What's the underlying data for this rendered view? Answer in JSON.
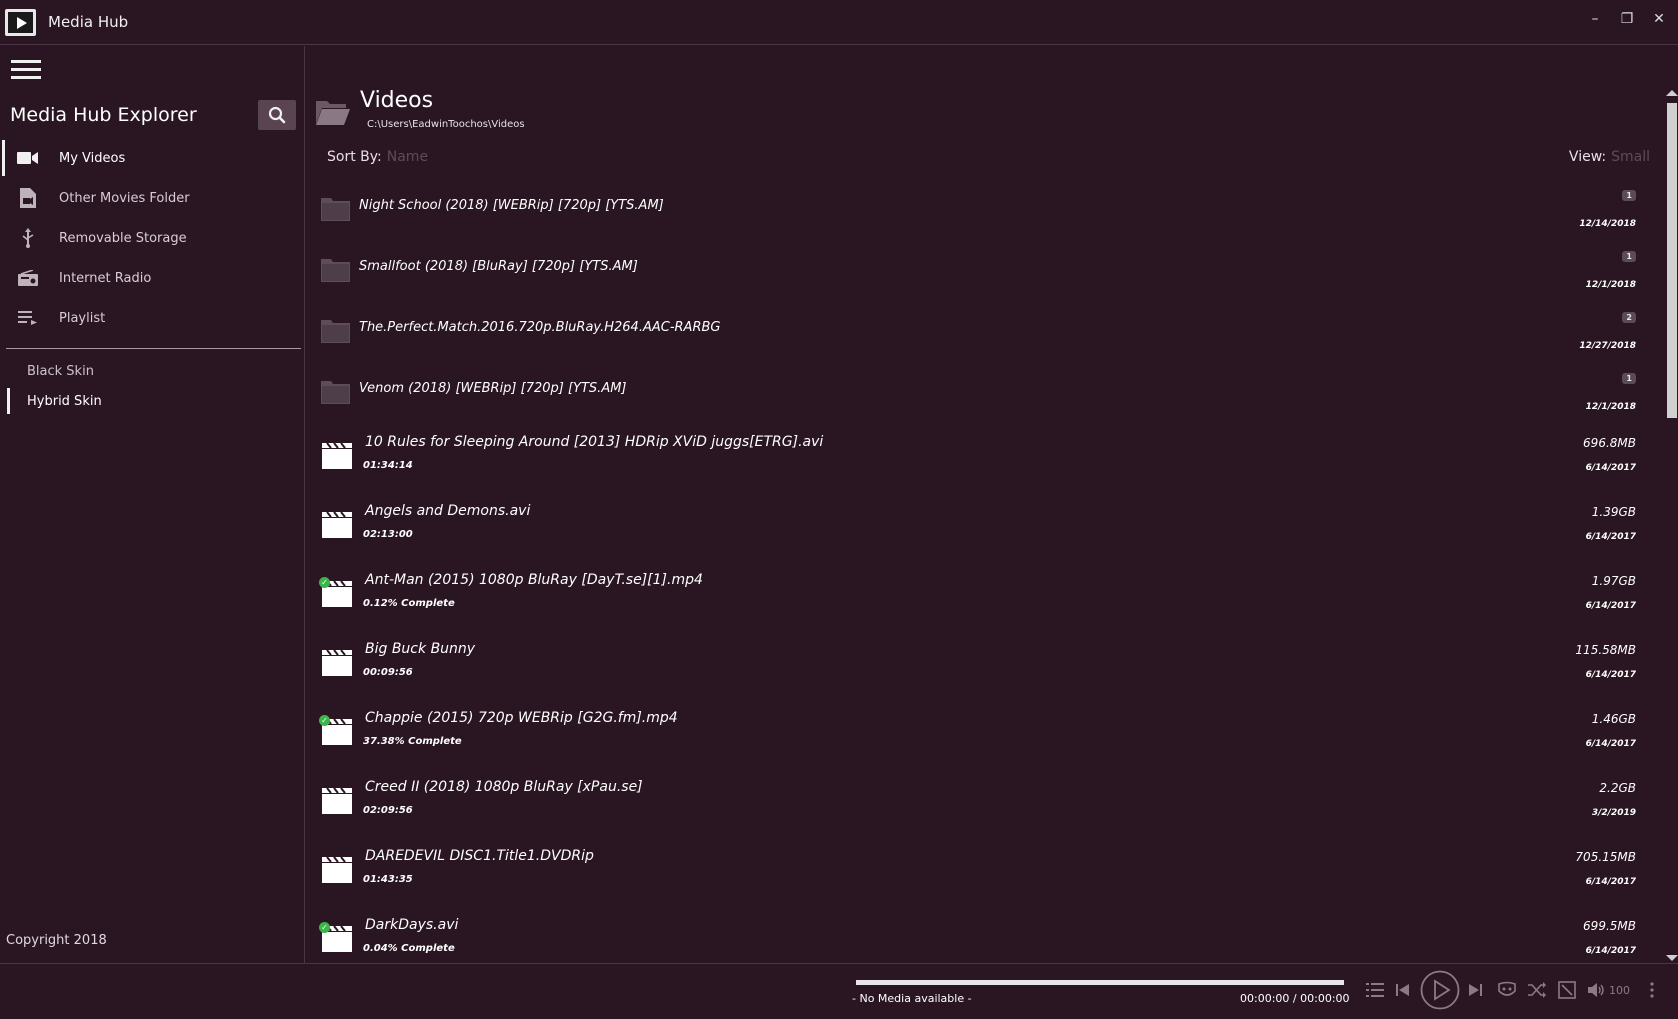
{
  "app": {
    "title": "Media Hub"
  },
  "window": {
    "minimize": "–",
    "restore": "❐",
    "close": "✕"
  },
  "sidebar": {
    "title": "Media Hub Explorer",
    "items": [
      {
        "label": "My Videos",
        "icon": "video-camera-icon",
        "active": true
      },
      {
        "label": "Other Movies Folder",
        "icon": "movie-file-icon",
        "active": false
      },
      {
        "label": "Removable Storage",
        "icon": "usb-icon",
        "active": false
      },
      {
        "label": "Internet Radio",
        "icon": "radio-icon",
        "active": false
      },
      {
        "label": "Playlist",
        "icon": "playlist-icon",
        "active": false
      }
    ],
    "skins": [
      {
        "label": "Black Skin",
        "active": false
      },
      {
        "label": "Hybrid Skin",
        "active": true
      }
    ],
    "copyright": "Copyright 2018"
  },
  "main": {
    "title": "Videos",
    "path": "C:\\Users\\EadwinToochos\\Videos",
    "sort_label": "Sort By:",
    "sort_value": "Name",
    "view_label": "View:",
    "view_value": "Small",
    "folders": [
      {
        "name": "Night School (2018) [WEBRip] [720p] [YTS.AM]",
        "count": "1",
        "date": "12/14/2018"
      },
      {
        "name": "Smallfoot (2018) [BluRay] [720p] [YTS.AM]",
        "count": "1",
        "date": "12/1/2018"
      },
      {
        "name": "The.Perfect.Match.2016.720p.BluRay.H264.AAC-RARBG",
        "count": "2",
        "date": "12/27/2018"
      },
      {
        "name": "Venom (2018) [WEBRip] [720p] [YTS.AM]",
        "count": "1",
        "date": "12/1/2018"
      }
    ],
    "videos": [
      {
        "name": "10 Rules for Sleeping Around [2013] HDRip XViD juggs[ETRG].avi",
        "sub": "01:34:14",
        "size": "696.8MB",
        "date": "6/14/2017",
        "watched": false
      },
      {
        "name": "Angels and Demons.avi",
        "sub": "02:13:00",
        "size": "1.39GB",
        "date": "6/14/2017",
        "watched": false
      },
      {
        "name": "Ant-Man (2015) 1080p BluRay [DayT.se][1].mp4",
        "sub": "0.12% Complete",
        "size": "1.97GB",
        "date": "6/14/2017",
        "watched": true
      },
      {
        "name": "Big Buck Bunny",
        "sub": "00:09:56",
        "size": "115.58MB",
        "date": "6/14/2017",
        "watched": false
      },
      {
        "name": "Chappie (2015) 720p WEBRip [G2G.fm].mp4",
        "sub": "37.38% Complete",
        "size": "1.46GB",
        "date": "6/14/2017",
        "watched": true
      },
      {
        "name": "Creed II (2018) 1080p BluRay [xPau.se]",
        "sub": "02:09:56",
        "size": "2.2GB",
        "date": "3/2/2019",
        "watched": false
      },
      {
        "name": "DAREDEVIL DISC1.Title1.DVDRip",
        "sub": "01:43:35",
        "size": "705.15MB",
        "date": "6/14/2017",
        "watched": false
      },
      {
        "name": "DarkDays.avi",
        "sub": "0.04% Complete",
        "size": "699.5MB",
        "date": "6/14/2017",
        "watched": true
      }
    ]
  },
  "player": {
    "status": "- No Media available -",
    "current_time": "00:00:00",
    "separator": "/",
    "total_time": "00:00:00",
    "volume": "100",
    "progress": 0
  },
  "colors": {
    "background": "#2a1622",
    "accent": "#5a4452",
    "watched": "#3bb54a"
  }
}
